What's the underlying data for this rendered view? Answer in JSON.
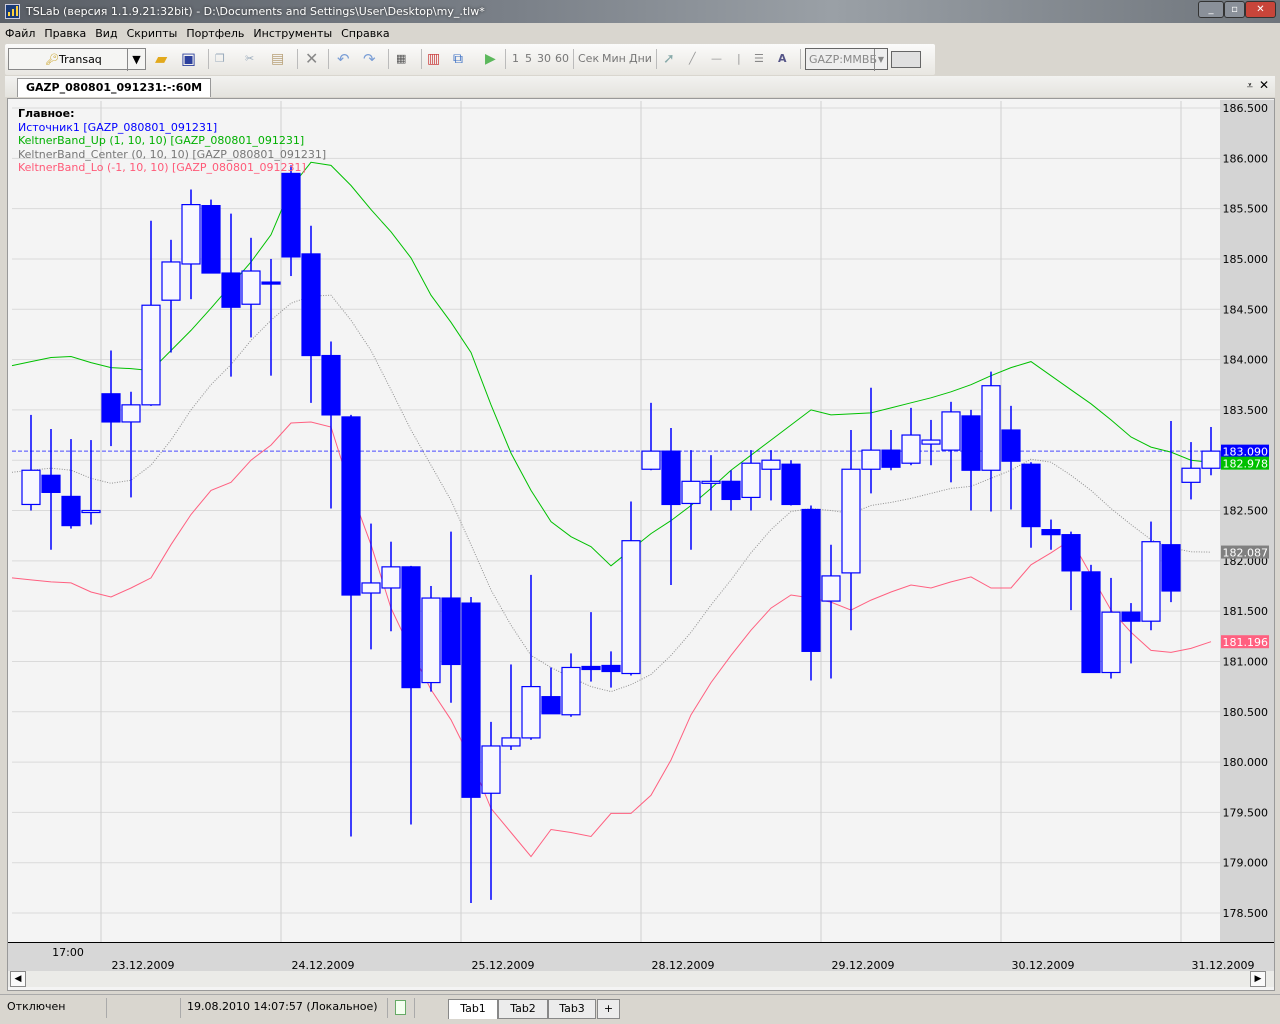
{
  "window": {
    "title": "TSLab (версия 1.1.9.21:32bit) - D:\\Documents and Settings\\User\\Desktop\\my_.tlw*",
    "controls": [
      "minimize",
      "maximize",
      "close"
    ]
  },
  "menu": [
    "Файл",
    "Правка",
    "Вид",
    "Скрипты",
    "Портфель",
    "Инструменты",
    "Справка"
  ],
  "toolbar": {
    "connector": "Transaq",
    "icons": [
      "open-folder",
      "save",
      "copy",
      "cut",
      "paste",
      "delete",
      "undo",
      "redo",
      "properties",
      "chart-bars",
      "network",
      "play"
    ],
    "intervals": [
      "1",
      "5",
      "30",
      "60"
    ],
    "units": [
      "Сек",
      "Мин",
      "Дни"
    ],
    "draw_tools": [
      "pointer",
      "line",
      "horizontal-line",
      "vertical-line",
      "fibonacci",
      "text"
    ],
    "instrument": "GAZP:ММВБ"
  },
  "chart_tab": {
    "label": "GAZP_080801_091231:-:60M"
  },
  "legend": {
    "header": "Главное:",
    "items": [
      {
        "label": "Источник1 [GAZP_080801_091231]",
        "color": "#0000ff"
      },
      {
        "label": "KeltnerBand_Up (1, 10, 10) [GAZP_080801_091231]",
        "color": "#00b000"
      },
      {
        "label": "KeltnerBand_Center (0, 10, 10) [GAZP_080801_091231]",
        "color": "#777777"
      },
      {
        "label": "KeltnerBand_Lo (-1, 10, 10) [GAZP_080801_091231]",
        "color": "#ff5a78"
      }
    ]
  },
  "status": {
    "connection": "Отключен",
    "datetime": "19.08.2010 14:07:57 (Локальное)",
    "tabs": [
      "Tab1",
      "Tab2",
      "Tab3"
    ],
    "add_tab": "+"
  },
  "chart_data": {
    "type": "candlestick",
    "ylim": [
      178.4,
      186.58
    ],
    "y_ticks": [
      "178.500",
      "179.000",
      "179.500",
      "180.000",
      "180.500",
      "181.000",
      "181.500",
      "182.000",
      "182.500",
      "183.000",
      "183.500",
      "184.000",
      "184.500",
      "185.000",
      "185.500",
      "186.000",
      "186.500"
    ],
    "grid": true,
    "x_ticks": [
      {
        "bar": 3,
        "label": "17:00",
        "row": 1
      },
      {
        "bar": 5,
        "label": "23.12.2009",
        "row": 2
      },
      {
        "bar": 14,
        "label": "24.12.2009",
        "row": 2
      },
      {
        "bar": 23,
        "label": "25.12.2009",
        "row": 2
      },
      {
        "bar": 32,
        "label": "28.12.2009",
        "row": 2
      },
      {
        "bar": 41,
        "label": "29.12.2009",
        "row": 2
      },
      {
        "bar": 50,
        "label": "30.12.2009",
        "row": 2
      },
      {
        "bar": 59,
        "label": "31.12.2009",
        "row": 2
      }
    ],
    "candles_ohlc": [
      [
        182.56,
        183.45,
        182.5,
        182.9
      ],
      [
        182.85,
        183.31,
        182.11,
        182.68
      ],
      [
        182.64,
        183.21,
        182.32,
        182.35
      ],
      [
        182.48,
        183.2,
        182.36,
        182.5
      ],
      [
        183.66,
        184.09,
        183.14,
        183.38
      ],
      [
        183.38,
        183.68,
        182.63,
        183.55
      ],
      [
        183.55,
        185.38,
        183.54,
        184.54
      ],
      [
        184.59,
        185.19,
        184.07,
        184.97
      ],
      [
        184.95,
        185.69,
        184.6,
        185.54
      ],
      [
        185.53,
        185.59,
        184.86,
        184.86
      ],
      [
        184.86,
        185.45,
        183.83,
        184.52
      ],
      [
        184.55,
        185.21,
        184.22,
        184.88
      ],
      [
        184.77,
        185.0,
        183.84,
        184.77
      ],
      [
        185.85,
        185.93,
        184.83,
        185.02
      ],
      [
        185.05,
        185.33,
        183.57,
        184.04
      ],
      [
        184.04,
        184.18,
        182.52,
        183.45
      ],
      [
        183.43,
        183.45,
        179.26,
        181.66
      ],
      [
        181.68,
        182.37,
        181.12,
        181.78
      ],
      [
        181.73,
        182.19,
        181.3,
        181.94
      ],
      [
        181.94,
        181.95,
        179.38,
        180.74
      ],
      [
        180.79,
        181.75,
        180.7,
        181.63
      ],
      [
        181.63,
        182.29,
        180.59,
        180.97
      ],
      [
        181.58,
        181.64,
        178.6,
        179.65
      ],
      [
        179.69,
        180.4,
        178.63,
        180.16
      ],
      [
        180.16,
        180.97,
        180.12,
        180.24
      ],
      [
        180.24,
        181.86,
        180.22,
        180.75
      ],
      [
        180.65,
        180.94,
        180.48,
        180.48
      ],
      [
        180.47,
        181.08,
        180.45,
        180.94
      ],
      [
        180.95,
        181.49,
        180.8,
        180.92
      ],
      [
        180.96,
        181.1,
        180.74,
        180.9
      ],
      [
        180.88,
        182.59,
        180.86,
        182.2
      ],
      [
        182.91,
        183.57,
        182.9,
        183.09
      ],
      [
        183.09,
        183.32,
        181.76,
        182.56
      ],
      [
        182.57,
        183.1,
        182.11,
        182.79
      ],
      [
        182.77,
        183.05,
        182.5,
        182.79
      ],
      [
        182.79,
        182.9,
        182.5,
        182.61
      ],
      [
        182.63,
        183.1,
        182.5,
        182.97
      ],
      [
        182.91,
        183.1,
        182.6,
        183.0
      ],
      [
        182.96,
        183.0,
        182.55,
        182.56
      ],
      [
        182.51,
        182.55,
        180.81,
        181.1
      ],
      [
        181.6,
        182.16,
        180.83,
        181.85
      ],
      [
        181.88,
        183.3,
        181.31,
        182.91
      ],
      [
        182.91,
        183.72,
        182.67,
        183.1
      ],
      [
        183.1,
        183.3,
        182.9,
        182.93
      ],
      [
        182.97,
        183.52,
        182.95,
        183.25
      ],
      [
        183.16,
        183.4,
        182.95,
        183.2
      ],
      [
        183.1,
        183.58,
        182.78,
        183.48
      ],
      [
        183.44,
        183.5,
        182.5,
        182.9
      ],
      [
        182.9,
        183.88,
        182.49,
        183.74
      ],
      [
        183.3,
        183.54,
        182.51,
        182.99
      ],
      [
        182.96,
        182.98,
        182.13,
        182.34
      ],
      [
        182.31,
        182.41,
        182.11,
        182.26
      ],
      [
        182.26,
        182.29,
        181.51,
        181.9
      ],
      [
        181.89,
        181.96,
        180.89,
        180.89
      ],
      [
        180.89,
        181.83,
        180.83,
        181.49
      ],
      [
        181.49,
        181.58,
        180.98,
        181.4
      ],
      [
        181.4,
        182.39,
        181.31,
        182.19
      ],
      [
        182.16,
        183.39,
        181.59,
        181.7
      ],
      [
        182.78,
        183.18,
        182.61,
        182.92
      ],
      [
        182.92,
        183.33,
        182.85,
        183.09
      ]
    ],
    "series": [
      {
        "name": "KeltnerBand_Up",
        "color": "#00c000",
        "style": "solid",
        "last_label": "182.978",
        "values": [
          183.98,
          184.02,
          184.03,
          183.97,
          183.92,
          183.91,
          183.89,
          184.09,
          184.29,
          184.51,
          184.74,
          184.97,
          185.24,
          185.71,
          185.96,
          185.93,
          185.73,
          185.49,
          185.27,
          185.01,
          184.64,
          184.37,
          184.07,
          183.55,
          183.07,
          182.7,
          182.39,
          182.24,
          182.14,
          181.95,
          182.11,
          182.27,
          182.4,
          182.55,
          182.72,
          182.9,
          183.05,
          183.2,
          183.35,
          183.5,
          183.45,
          183.46,
          183.47,
          183.52,
          183.57,
          183.62,
          183.68,
          183.75,
          183.84,
          183.92,
          183.98,
          183.84,
          183.7,
          183.56,
          183.4,
          183.23,
          183.13,
          183.08,
          183.0,
          182.978
        ]
      },
      {
        "name": "KeltnerBand_Center",
        "color": "#909090",
        "style": "dotted",
        "last_label": "182.087",
        "values": [
          182.9,
          182.92,
          182.9,
          182.82,
          182.77,
          182.8,
          182.95,
          183.2,
          183.5,
          183.75,
          183.95,
          184.19,
          184.39,
          184.56,
          184.63,
          184.64,
          184.39,
          184.09,
          183.7,
          183.3,
          182.95,
          182.6,
          182.16,
          181.71,
          181.36,
          181.06,
          180.94,
          180.84,
          180.75,
          180.7,
          180.77,
          180.87,
          181.06,
          181.29,
          181.56,
          181.81,
          182.08,
          182.31,
          182.49,
          182.52,
          182.5,
          182.47,
          182.55,
          182.58,
          182.62,
          182.67,
          182.72,
          182.74,
          182.82,
          182.9,
          183.01,
          182.98,
          182.85,
          182.7,
          182.52,
          182.36,
          182.21,
          182.13,
          182.09,
          182.087
        ]
      },
      {
        "name": "KeltnerBand_Lo",
        "color": "#ff6080",
        "style": "solid",
        "last_label": "181.196",
        "values": [
          181.81,
          181.79,
          181.78,
          181.69,
          181.64,
          181.73,
          181.83,
          182.16,
          182.46,
          182.7,
          182.78,
          183.0,
          183.15,
          183.37,
          183.38,
          183.33,
          182.7,
          182.16,
          181.53,
          181.11,
          180.72,
          180.42,
          180.02,
          179.54,
          179.3,
          179.06,
          179.33,
          179.3,
          179.26,
          179.49,
          179.49,
          179.67,
          180.02,
          180.47,
          180.79,
          181.06,
          181.31,
          181.53,
          181.66,
          181.63,
          181.59,
          181.51,
          181.61,
          181.69,
          181.76,
          181.73,
          181.79,
          181.84,
          181.73,
          181.73,
          181.96,
          182.08,
          182.21,
          181.86,
          181.51,
          181.29,
          181.11,
          181.09,
          181.13,
          181.196
        ]
      }
    ],
    "last_price": {
      "value": 183.09,
      "label": "183.090",
      "color": "#0000ff"
    },
    "candle_color": "#0000ff"
  }
}
